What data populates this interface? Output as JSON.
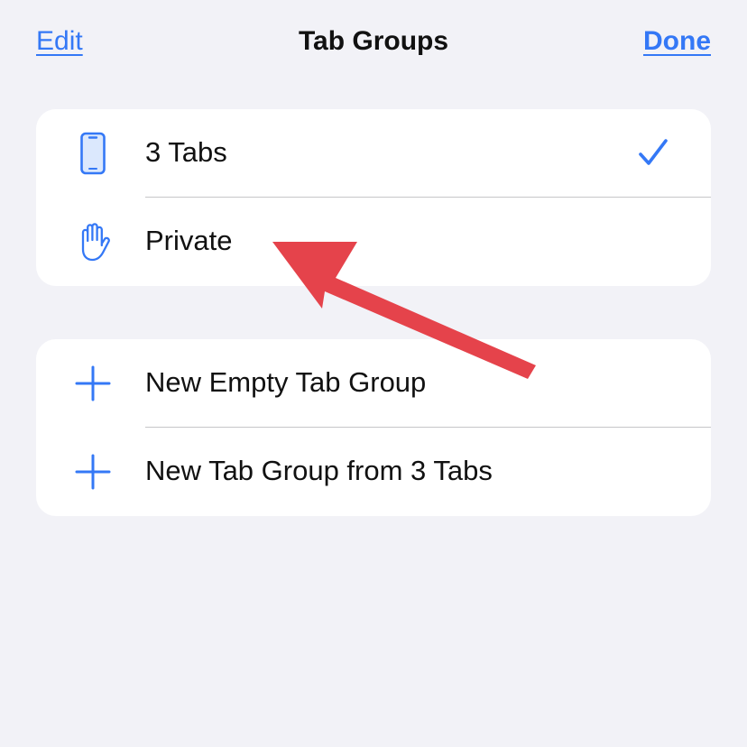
{
  "nav": {
    "edit_label": "Edit",
    "title": "Tab Groups",
    "done_label": "Done"
  },
  "groups": [
    {
      "label": "3 Tabs",
      "icon": "iphone-icon",
      "selected": true
    },
    {
      "label": "Private",
      "icon": "hand-raised-icon",
      "selected": false
    }
  ],
  "actions": [
    {
      "label": "New Empty Tab Group",
      "icon": "plus-icon"
    },
    {
      "label": "New Tab Group from 3 Tabs",
      "icon": "plus-icon"
    }
  ],
  "colors": {
    "accent": "#3478f6",
    "background": "#f2f2f7",
    "annotation_arrow": "#e5434b"
  }
}
